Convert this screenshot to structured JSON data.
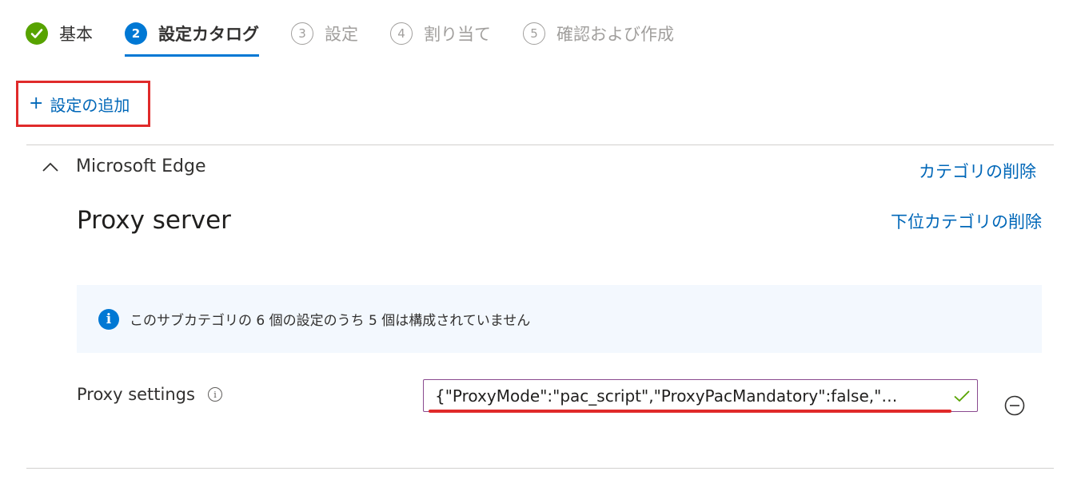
{
  "stepper": {
    "steps": [
      {
        "number": "",
        "label": "基本",
        "state": "done"
      },
      {
        "number": "2",
        "label": "設定カタログ",
        "state": "current"
      },
      {
        "number": "3",
        "label": "設定",
        "state": "future"
      },
      {
        "number": "4",
        "label": "割り当て",
        "state": "future"
      },
      {
        "number": "5",
        "label": "確認および作成",
        "state": "future"
      }
    ]
  },
  "toolbar": {
    "add_setting_label": "設定の追加",
    "add_setting_icon": "plus-icon"
  },
  "category": {
    "name": "Microsoft Edge",
    "expand_icon": "chevron-up-icon",
    "remove_category_label": "カテゴリの削除",
    "subcategory": {
      "name": "Proxy server",
      "remove_subcategory_label": "下位カテゴリの削除",
      "info_message": "このサブカテゴリの 6 個の設定のうち 5 個は構成されていません",
      "settings": [
        {
          "label": "Proxy settings",
          "value": "{\"ProxyMode\":\"pac_script\",\"ProxyPacMandatory\":false,\"…",
          "valid": true
        }
      ]
    }
  },
  "colors": {
    "accent": "#0078d4",
    "link": "#0067b8",
    "success": "#57a300",
    "highlight": "#e02a2a",
    "info_background": "#f3f8fe"
  }
}
